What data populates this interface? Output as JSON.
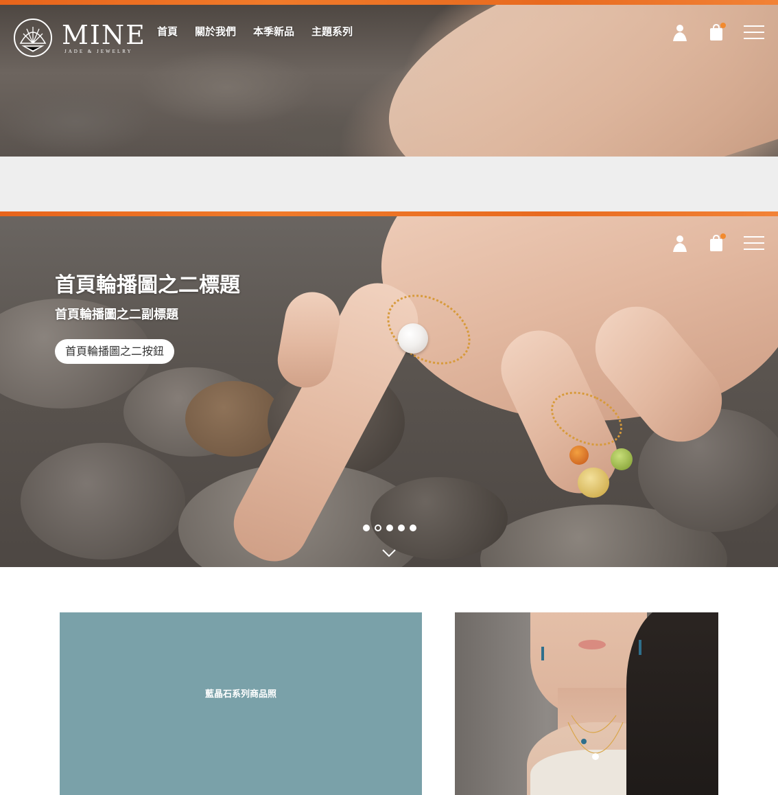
{
  "brand": {
    "name": "MINE",
    "tagline": "JADE & JEWELRY"
  },
  "nav": {
    "items": [
      {
        "label": "首頁"
      },
      {
        "label": "關於我們"
      },
      {
        "label": "本季新品"
      },
      {
        "label": "主題系列"
      }
    ]
  },
  "header_icons": [
    "user-icon",
    "shopping-bag-icon",
    "menu-icon"
  ],
  "slider": {
    "title": "首頁輪播圖之二標題",
    "subtitle": "首頁輪播圖之二副標題",
    "button_label": "首頁輪播圖之二按鈕",
    "slide_count": 5,
    "active_index": 1
  },
  "products": {
    "blue_card_label": "藍晶石系列商品照"
  },
  "colors": {
    "accent_orange": "#e8641b",
    "cart_badge": "#f28a2e",
    "card_teal": "#7aa1a9",
    "band_gray": "#eeeeee"
  }
}
